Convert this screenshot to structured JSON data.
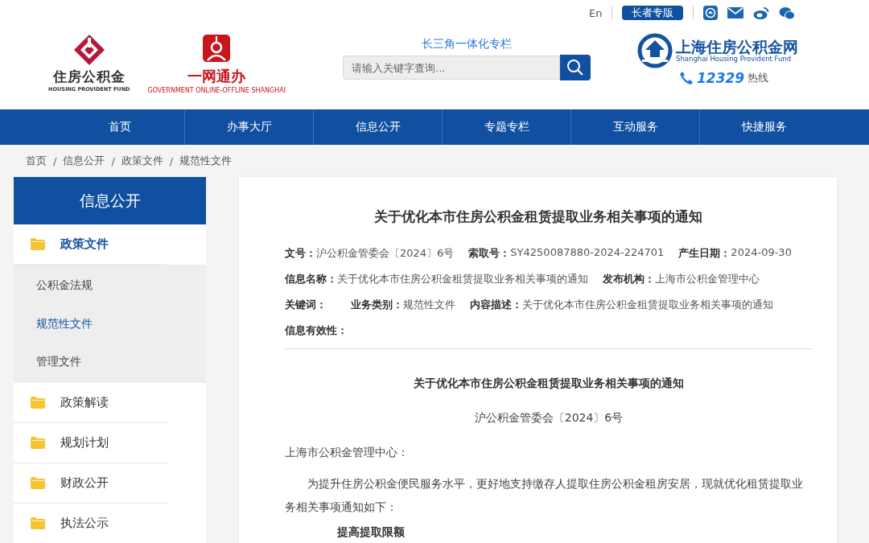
{
  "topbar": {
    "language_link": "En",
    "elder_button": "长者专版"
  },
  "logos": {
    "fund_name": "住房公积金",
    "fund_english": "HOUSING PROVIDENT FUND",
    "service_name": "一网通办",
    "service_english": "GOVERNMENT ONLINE-OFFLINE SHANGHAI",
    "site_name": "上海住房公积金网",
    "site_english": "Shanghai Housing Provident Fund",
    "hotline_number": "12329",
    "hotline_label": "热线"
  },
  "search": {
    "column_link": "长三角一体化专栏",
    "placeholder": "请输入关键字查询..."
  },
  "nav": [
    {
      "label": "首页",
      "selected": false
    },
    {
      "label": "办事大厅",
      "selected": false
    },
    {
      "label": "信息公开",
      "selected": false
    },
    {
      "label": "专题专栏",
      "selected": false
    },
    {
      "label": "互动服务",
      "selected": false
    },
    {
      "label": "快捷服务",
      "selected": false
    }
  ],
  "breadcrumb": {
    "separator": "/",
    "items": [
      "首页",
      "信息公开",
      "政策文件",
      "规范性文件"
    ]
  },
  "sidebar": {
    "title": "信息公开",
    "items": [
      {
        "label": "政策文件",
        "selected": true,
        "expanded": true,
        "children": [
          {
            "label": "公积金法规",
            "selected": false
          },
          {
            "label": "规范性文件",
            "selected": true
          },
          {
            "label": "管理文件",
            "selected": false
          }
        ]
      },
      {
        "label": "政策解读",
        "selected": false,
        "expanded": false
      },
      {
        "label": "规划计划",
        "selected": false,
        "expanded": false
      },
      {
        "label": "财政公开",
        "selected": false,
        "expanded": false
      },
      {
        "label": "执法公示",
        "selected": false,
        "expanded": false
      }
    ]
  },
  "article": {
    "title": "关于优化本市住房公积金租赁提取业务相关事项的通知",
    "meta": [
      [
        {
          "label": "文号：",
          "value": "沪公积金管委会〔2024〕6号"
        },
        {
          "label": "索取号：",
          "value": "SY4250087880-2024-224701"
        },
        {
          "label": "产生日期：",
          "value": "2024-09-30"
        }
      ],
      [
        {
          "label": "信息名称：",
          "value": "关于优化本市住房公积金租赁提取业务相关事项的通知"
        },
        {
          "label": "发布机构：",
          "value": "上海市公积金管理中心"
        }
      ],
      [
        {
          "label": "关键词："
        },
        {
          "label": "业务类别：",
          "value": "规范性文件"
        },
        {
          "label": "内容描述：",
          "value": "关于优化本市住房公积金租赁提取业务相关事项的通知"
        }
      ],
      [
        {
          "label": "信息有效性："
        }
      ]
    ],
    "body": [
      {
        "kind": "heading",
        "text": "关于优化本市住房公积金租赁提取业务相关事项的通知"
      },
      {
        "kind": "number",
        "text": "沪公积金管委会〔2024〕6号"
      },
      {
        "kind": "salutation",
        "text": "上海市公积金管理中心："
      },
      {
        "kind": "paragraph",
        "text": "为提升住房公积金便民服务水平，更好地支持缴存人提取住房公积金租房安居，现就优化租赁提取业务相关事项通知如下："
      },
      {
        "kind": "section",
        "text": "提高提取限额"
      }
    ]
  }
}
